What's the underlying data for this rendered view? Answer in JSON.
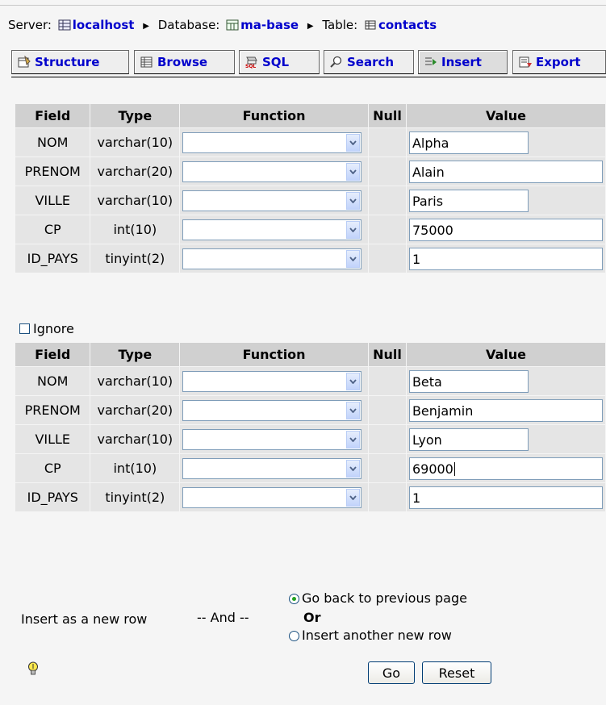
{
  "breadcrumb": {
    "server_label": "Server:",
    "server_name": "localhost",
    "database_label": "Database:",
    "database_name": "ma-base",
    "table_label": "Table:",
    "table_name": "contacts"
  },
  "tabs": [
    {
      "label": "Structure",
      "icon": "structure-icon"
    },
    {
      "label": "Browse",
      "icon": "browse-icon"
    },
    {
      "label": "SQL",
      "icon": "sql-icon"
    },
    {
      "label": "Search",
      "icon": "search-icon"
    },
    {
      "label": "Insert",
      "icon": "insert-icon",
      "active": true
    },
    {
      "label": "Export",
      "icon": "export-icon"
    }
  ],
  "table_headers": {
    "field": "Field",
    "type": "Type",
    "function": "Function",
    "null": "Null",
    "value": "Value"
  },
  "rows1": [
    {
      "field": "NOM",
      "type": "varchar(10)",
      "value": "Alpha"
    },
    {
      "field": "PRENOM",
      "type": "varchar(20)",
      "value": "Alain"
    },
    {
      "field": "VILLE",
      "type": "varchar(10)",
      "value": "Paris"
    },
    {
      "field": "CP",
      "type": "int(10)",
      "value": "75000"
    },
    {
      "field": "ID_PAYS",
      "type": "tinyint(2)",
      "value": "1"
    }
  ],
  "ignore_label": "Ignore",
  "rows2": [
    {
      "field": "NOM",
      "type": "varchar(10)",
      "value": "Beta"
    },
    {
      "field": "PRENOM",
      "type": "varchar(20)",
      "value": "Benjamin"
    },
    {
      "field": "VILLE",
      "type": "varchar(10)",
      "value": "Lyon"
    },
    {
      "field": "CP",
      "type": "int(10)",
      "value": "69000"
    },
    {
      "field": "ID_PAYS",
      "type": "tinyint(2)",
      "value": "1"
    }
  ],
  "footer": {
    "insert_as": "Insert as a new row",
    "and": "-- And --",
    "option_back": "Go back to previous page",
    "or": "Or",
    "option_another": "Insert another new row",
    "go": "Go",
    "reset": "Reset"
  },
  "colors": {
    "link": "#0000cc",
    "header_bg": "#d0d0d0",
    "cell_bg": "#e5e5e5"
  }
}
